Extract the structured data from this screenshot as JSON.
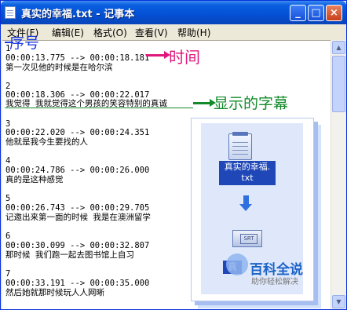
{
  "window": {
    "title": "真实的幸福.txt - 记事本"
  },
  "menu": [
    "文件(F)",
    "编辑(E)",
    "格式(O)",
    "查看(V)",
    "帮助(H)"
  ],
  "content": [
    "1",
    "00:00:13.775 --> 00:00:18.181",
    "第一次见他的时候是在哈尔滨",
    "",
    "2",
    "00:00:18.306 --> 00:00:22.017",
    "我觉得 我就觉得这个男孩的笑容特别的真诚",
    "",
    "3",
    "00:00:22.020 --> 00:00:24.351",
    "他就是我今生要找的人",
    "",
    "4",
    "00:00:24.786 --> 00:00:26.000",
    "真的是这种感觉",
    "",
    "5",
    "00:00:26.743 --> 00:00:29.705",
    "记邀出来第一面的时候 我是在澳洲留学",
    "",
    "6",
    "00:00:30.099 --> 00:00:32.807",
    "那时候 我们跑一起去图书馆上自习",
    "",
    "7",
    "00:00:33.191 --> 00:00:35.000",
    "然后她就那时候玩人人网晰"
  ],
  "annotations": {
    "sequence": "序号",
    "time": "时间",
    "subtitle": "显示的字幕"
  },
  "panel": {
    "txt_file_name_line1": "真实的幸福.",
    "txt_file_name_line2": "txt",
    "srt_badge": "SRT",
    "srt_file_label": "真"
  },
  "watermark": {
    "title": "百科全说",
    "subtitle": "助你轻松解决"
  },
  "colors": {
    "sequence_annotation": "#1d3be0",
    "time_annotation": "#e0177a",
    "subtitle_annotation": "#138a2a",
    "titlebar": "#0a5fe0"
  }
}
